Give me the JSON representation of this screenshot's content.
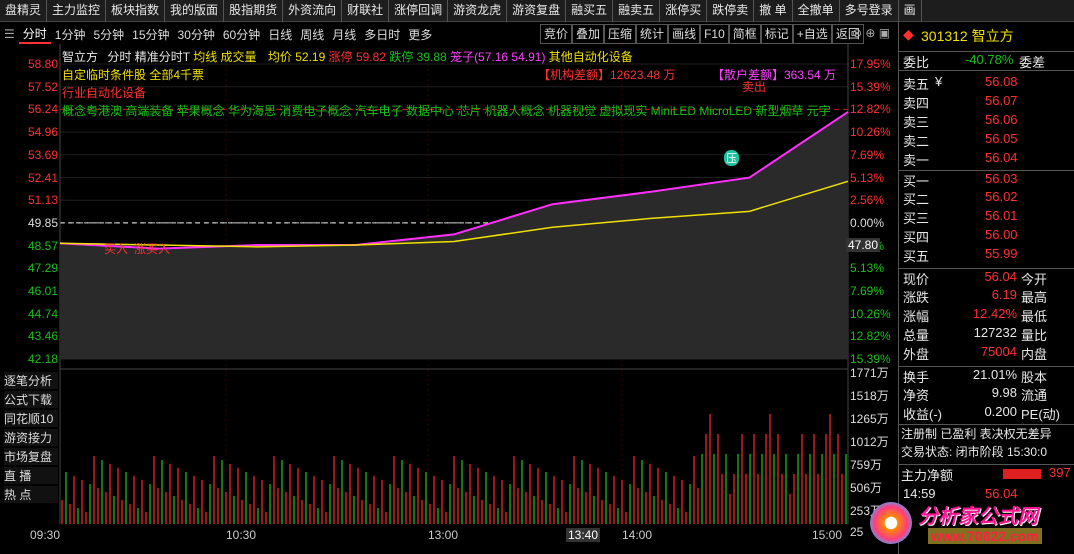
{
  "topbar": {
    "buttons": [
      "盘精灵",
      "主力监控",
      "板块指数",
      "我的版面",
      "股指期货",
      "外资流向",
      "财联社",
      "涨停回调",
      "游资龙虎",
      "游资复盘",
      "融买五",
      "融卖五",
      "涨停买",
      "跌停卖",
      "撤 单",
      "全撤单",
      "多号登录",
      "画"
    ]
  },
  "period_tabs": [
    "分时",
    "1分钟",
    "5分钟",
    "15分钟",
    "30分钟",
    "60分钟",
    "日线",
    "周线",
    "月线",
    "多日时",
    "更多"
  ],
  "toolbar": [
    "竞价",
    "叠加",
    "压缩",
    "统计",
    "画线",
    "F10",
    "简框",
    "标记",
    "+自选",
    "返回"
  ],
  "chart_header": {
    "name": "智立方",
    "mode": "分时",
    "template": "精准分时T",
    "avg_label": "均线",
    "vol_label": "成交量",
    "avg_price": "均价 52.19",
    "limit_up": "涨停 59.82",
    "limit_down": "跌停 39.88",
    "range": "笼子(57.16 54.91)",
    "industry": "其他自动化设备",
    "condition": "自定临时条件股 全部4千票",
    "sector_line": "行业自动化设备",
    "inst_amount": "【机构差额】12623.48 万",
    "retail_amount": "【散户差额】363.54 万",
    "concepts": "概念粤港澳 高端装备 苹果概念 华为海思 消费电子概念 汽车电子 数据中心 芯片 机器人概念 机器视觉 虚拟现实 MiniLED MicroLED 新型烟草 元宇"
  },
  "axis": {
    "prices": [
      "58.80",
      "57.52",
      "56.24",
      "54.96",
      "53.69",
      "52.41",
      "51.13",
      "49.85",
      "48.57",
      "47.29",
      "46.01",
      "44.74",
      "43.46",
      "42.18"
    ],
    "pcts": [
      "17.95%",
      "15.39%",
      "12.82%",
      "10.26%",
      "7.69%",
      "5.13%",
      "2.56%",
      "0.00%",
      "2.56%",
      "5.13%",
      "7.69%",
      "10.26%",
      "12.82%",
      "15.39%"
    ],
    "cursor_price": "47.80",
    "volumes": [
      "1771万",
      "1518万",
      "1265万",
      "1012万",
      "759万",
      "506万",
      "253万",
      "25"
    ],
    "times": [
      "09:30",
      "10:30",
      "13:00",
      "13:40",
      "14:00",
      "15:00"
    ]
  },
  "annotations": {
    "buy": "买入",
    "sell": "卖出",
    "pressure": "压",
    "buy_label2": "涨买入"
  },
  "side_buttons": [
    "逐笔分析",
    "公式下载",
    "同花顺10",
    "游资接力",
    "市场复盘",
    "直 播",
    "热 点"
  ],
  "quote": {
    "code_name": "301312 智立方",
    "weibi_label": "委比",
    "weibi": "-40.78%",
    "weicha_label": "委差",
    "asks": [
      {
        "label": "卖五",
        "price": "56.08"
      },
      {
        "label": "卖四",
        "price": "56.07"
      },
      {
        "label": "卖三",
        "price": "56.06"
      },
      {
        "label": "卖二",
        "price": "56.05"
      },
      {
        "label": "卖一",
        "price": "56.04"
      }
    ],
    "ask_currency": "¥",
    "bids": [
      {
        "label": "买一",
        "price": "56.03"
      },
      {
        "label": "买二",
        "price": "56.02"
      },
      {
        "label": "买三",
        "price": "56.01"
      },
      {
        "label": "买四",
        "price": "56.00"
      },
      {
        "label": "买五",
        "price": "55.99"
      }
    ],
    "stats": [
      {
        "l": "现价",
        "v": "56.04",
        "r": "今开"
      },
      {
        "l": "涨跌",
        "v": "6.19",
        "r": "最高"
      },
      {
        "l": "涨幅",
        "v": "12.42%",
        "r": "最低"
      },
      {
        "l": "总量",
        "v": "127232",
        "r": "量比"
      },
      {
        "l": "外盘",
        "v": "75004",
        "r": "内盘"
      },
      {
        "l": "换手",
        "v": "21.01%",
        "r": "股本"
      },
      {
        "l": "净资",
        "v": "9.98",
        "r": "流通"
      },
      {
        "l": "收益(-)",
        "v": "0.200",
        "r": "PE(动)"
      }
    ],
    "tags": "注册制 已盈利 表决权无差异",
    "trade_status": "交易状态: 闭市阶段 15:30:0",
    "net_flow_label": "主力净额",
    "net_flow_value": "397",
    "tick_time": "14:59",
    "tick_price": "56.04"
  },
  "watermark": {
    "line1": "分析家公式网",
    "line2": "www.70822.com"
  },
  "chart_data": {
    "type": "line",
    "x": [
      "09:30",
      "10:00",
      "10:30",
      "11:00",
      "11:30/13:00",
      "13:30",
      "14:00",
      "14:30",
      "15:00"
    ],
    "series": [
      {
        "name": "价格",
        "values": [
          48.7,
          48.4,
          48.6,
          48.6,
          49.2,
          50.9,
          51.6,
          52.4,
          56.1
        ]
      },
      {
        "name": "均价",
        "values": [
          48.7,
          48.6,
          48.5,
          48.6,
          48.8,
          49.6,
          50.1,
          50.5,
          52.19
        ]
      }
    ],
    "prev_close": 49.85,
    "ylim": [
      42.18,
      58.8
    ]
  }
}
